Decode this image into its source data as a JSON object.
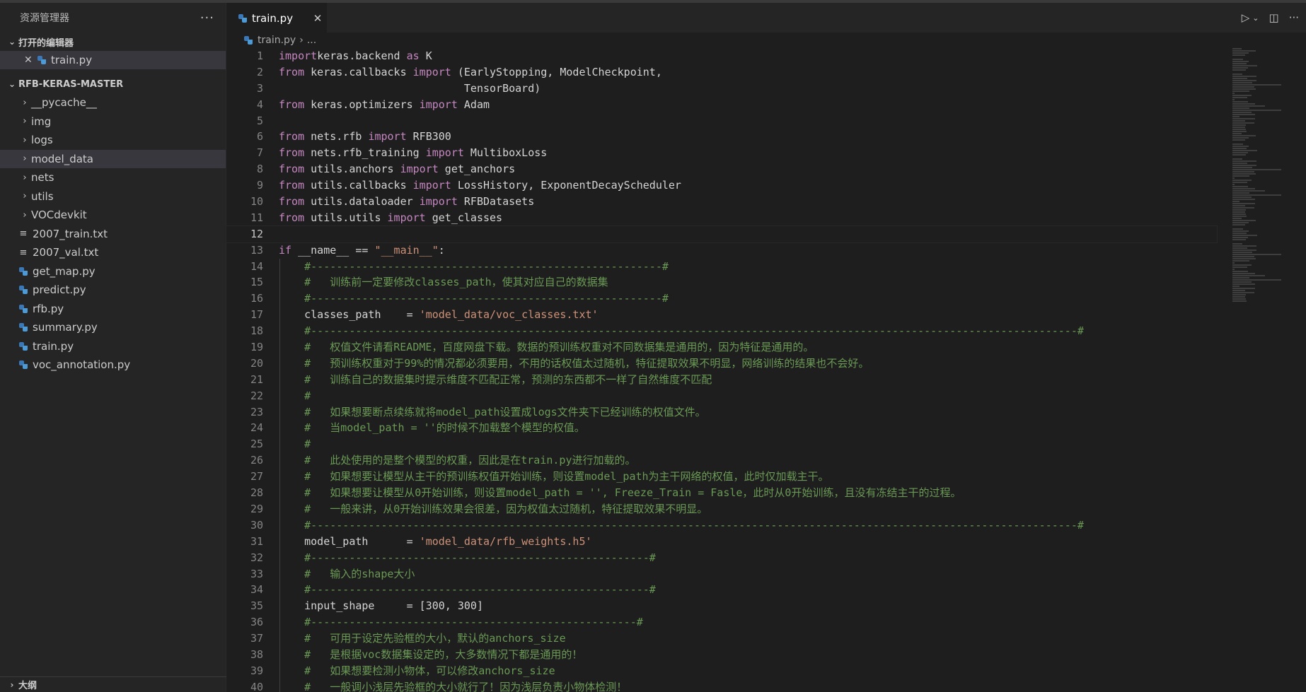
{
  "sidebar": {
    "title": "资源管理器",
    "more_icon": "ellipsis-icon",
    "open_editors_label": "打开的编辑器",
    "open_editor_file": "train.py",
    "project_label": "RFB-KERAS-MASTER",
    "folders": [
      "__pycache__",
      "img",
      "logs",
      "model_data",
      "nets",
      "utils",
      "VOCdevkit"
    ],
    "selected_folder": "model_data",
    "files": [
      {
        "name": "2007_train.txt",
        "type": "txt"
      },
      {
        "name": "2007_val.txt",
        "type": "txt"
      },
      {
        "name": "get_map.py",
        "type": "py"
      },
      {
        "name": "predict.py",
        "type": "py"
      },
      {
        "name": "rfb.py",
        "type": "py"
      },
      {
        "name": "summary.py",
        "type": "py"
      },
      {
        "name": "train.py",
        "type": "py"
      },
      {
        "name": "voc_annotation.py",
        "type": "py"
      }
    ],
    "outline_label": "大纲"
  },
  "editor": {
    "tab_label": "train.py",
    "breadcrumb_file": "train.py",
    "breadcrumb_rest": "...",
    "active_line": 12,
    "accent_color": "#569cd6"
  },
  "code_lines": [
    [
      [
        "kw2",
        "import"
      ],
      [
        "",
        "keras.backend "
      ],
      [
        "kw2",
        "as"
      ],
      [
        "",
        " K"
      ]
    ],
    [
      [
        "kw2",
        "from"
      ],
      [
        "",
        " keras.callbacks "
      ],
      [
        "kw2",
        "import"
      ],
      [
        "",
        " (EarlyStopping, ModelCheckpoint,"
      ]
    ],
    [
      [
        "",
        "                             TensorBoard)"
      ]
    ],
    [
      [
        "kw2",
        "from"
      ],
      [
        "",
        " keras.optimizers "
      ],
      [
        "kw2",
        "import"
      ],
      [
        "",
        " Adam"
      ]
    ],
    [],
    [
      [
        "kw2",
        "from"
      ],
      [
        "",
        " nets.rfb "
      ],
      [
        "kw2",
        "import"
      ],
      [
        "",
        " RFB300"
      ]
    ],
    [
      [
        "kw2",
        "from"
      ],
      [
        "",
        " nets.rfb_training "
      ],
      [
        "kw2",
        "import"
      ],
      [
        "",
        " MultiboxLoss"
      ]
    ],
    [
      [
        "kw2",
        "from"
      ],
      [
        "",
        " utils.anchors "
      ],
      [
        "kw2",
        "import"
      ],
      [
        "",
        " get_anchors"
      ]
    ],
    [
      [
        "kw2",
        "from"
      ],
      [
        "",
        " utils.callbacks "
      ],
      [
        "kw2",
        "import"
      ],
      [
        "",
        " LossHistory, ExponentDecayScheduler"
      ]
    ],
    [
      [
        "kw2",
        "from"
      ],
      [
        "",
        " utils.dataloader "
      ],
      [
        "kw2",
        "import"
      ],
      [
        "",
        " RFBDatasets"
      ]
    ],
    [
      [
        "kw2",
        "from"
      ],
      [
        "",
        " utils.utils "
      ],
      [
        "kw2",
        "import"
      ],
      [
        "",
        " get_classes"
      ]
    ],
    [],
    [
      [
        "kw2",
        "if"
      ],
      [
        "",
        " __name__ == "
      ],
      [
        "str",
        "\"__main__\""
      ],
      [
        "",
        ":"
      ]
    ],
    [
      [
        "",
        "    "
      ],
      [
        "cm",
        "#-------------------------------------------------------#"
      ]
    ],
    [
      [
        "",
        "    "
      ],
      [
        "cm",
        "#   训练前一定要修改classes_path，使其对应自己的数据集"
      ]
    ],
    [
      [
        "",
        "    "
      ],
      [
        "cm",
        "#-------------------------------------------------------#"
      ]
    ],
    [
      [
        "",
        "    classes_path    = "
      ],
      [
        "str",
        "'model_data/voc_classes.txt'"
      ]
    ],
    [
      [
        "",
        "    "
      ],
      [
        "cm",
        "#------------------------------------------------------------------------------------------------------------------------#"
      ]
    ],
    [
      [
        "",
        "    "
      ],
      [
        "cm",
        "#   权值文件请看README，百度网盘下载。数据的预训练权重对不同数据集是通用的，因为特征是通用的。"
      ]
    ],
    [
      [
        "",
        "    "
      ],
      [
        "cm",
        "#   预训练权重对于99%的情况都必须要用，不用的话权值太过随机，特征提取效果不明显，网络训练的结果也不会好。"
      ]
    ],
    [
      [
        "",
        "    "
      ],
      [
        "cm",
        "#   训练自己的数据集时提示维度不匹配正常，预测的东西都不一样了自然维度不匹配"
      ]
    ],
    [
      [
        "",
        "    "
      ],
      [
        "cm",
        "#"
      ]
    ],
    [
      [
        "",
        "    "
      ],
      [
        "cm",
        "#   如果想要断点续练就将model_path设置成logs文件夹下已经训练的权值文件。"
      ]
    ],
    [
      [
        "",
        "    "
      ],
      [
        "cm",
        "#   当model_path = ''的时候不加载整个模型的权值。"
      ]
    ],
    [
      [
        "",
        "    "
      ],
      [
        "cm",
        "#"
      ]
    ],
    [
      [
        "",
        "    "
      ],
      [
        "cm",
        "#   此处使用的是整个模型的权重，因此是在train.py进行加载的。"
      ]
    ],
    [
      [
        "",
        "    "
      ],
      [
        "cm",
        "#   如果想要让模型从主干的预训练权值开始训练，则设置model_path为主干网络的权值，此时仅加载主干。"
      ]
    ],
    [
      [
        "",
        "    "
      ],
      [
        "cm",
        "#   如果想要让模型从0开始训练，则设置model_path = '', Freeze_Train = Fasle，此时从0开始训练，且没有冻结主干的过程。"
      ]
    ],
    [
      [
        "",
        "    "
      ],
      [
        "cm",
        "#   一般来讲，从0开始训练效果会很差，因为权值太过随机，特征提取效果不明显。"
      ]
    ],
    [
      [
        "",
        "    "
      ],
      [
        "cm",
        "#------------------------------------------------------------------------------------------------------------------------#"
      ]
    ],
    [
      [
        "",
        "    model_path      = "
      ],
      [
        "str",
        "'model_data/rfb_weights.h5'"
      ]
    ],
    [
      [
        "",
        "    "
      ],
      [
        "cm",
        "#-----------------------------------------------------#"
      ]
    ],
    [
      [
        "",
        "    "
      ],
      [
        "cm",
        "#   输入的shape大小"
      ]
    ],
    [
      [
        "",
        "    "
      ],
      [
        "cm",
        "#-----------------------------------------------------#"
      ]
    ],
    [
      [
        "",
        "    input_shape     = [300, 300]"
      ]
    ],
    [
      [
        "",
        "    "
      ],
      [
        "cm",
        "#---------------------------------------------------#"
      ]
    ],
    [
      [
        "",
        "    "
      ],
      [
        "cm",
        "#   可用于设定先验框的大小，默认的anchors_size"
      ]
    ],
    [
      [
        "",
        "    "
      ],
      [
        "cm",
        "#   是根据voc数据集设定的，大多数情况下都是通用的！"
      ]
    ],
    [
      [
        "",
        "    "
      ],
      [
        "cm",
        "#   如果想要检测小物体，可以修改anchors_size"
      ]
    ],
    [
      [
        "",
        "    "
      ],
      [
        "cm",
        "#   一般调小浅层先验框的大小就行了！因为浅层负责小物体检测！"
      ]
    ]
  ]
}
